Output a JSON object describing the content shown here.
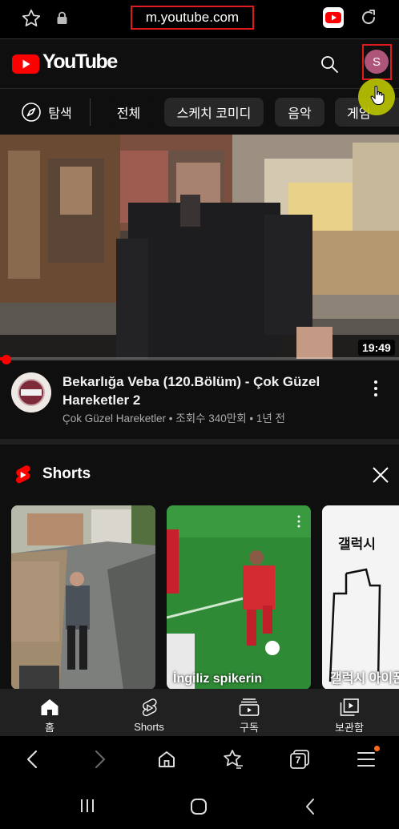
{
  "browser": {
    "url": "m.youtube.com",
    "tab_count": "7"
  },
  "header": {
    "logo_text": "YouTube",
    "avatar_letter": "S"
  },
  "chips": [
    {
      "label": "탐색"
    },
    {
      "label": "전체"
    },
    {
      "label": "스케치 코미디"
    },
    {
      "label": "음악"
    },
    {
      "label": "게임"
    }
  ],
  "video": {
    "duration": "19:49",
    "title": "Bekarlığa Veba (120.Bölüm) - Çok Güzel Hareketler 2",
    "meta": "Çok Güzel Hareketler • 조회수 340만회 • 1년 전",
    "progress": 0.02
  },
  "shorts": {
    "title": "Shorts",
    "items": [
      {
        "caption": ""
      },
      {
        "caption": "İngiliz spikerin"
      },
      {
        "caption": "갤럭시 아이폰",
        "overlay_text": "갤럭시"
      }
    ]
  },
  "bottom_nav": [
    {
      "label": "홈",
      "icon": "home-icon"
    },
    {
      "label": "Shorts",
      "icon": "shorts-icon"
    },
    {
      "label": "구독",
      "icon": "subscriptions-icon"
    },
    {
      "label": "보관함",
      "icon": "library-icon"
    }
  ],
  "colors": {
    "accent": "#ff0000",
    "highlight_box": "#e01b1b",
    "background": "#0f0f0f"
  }
}
